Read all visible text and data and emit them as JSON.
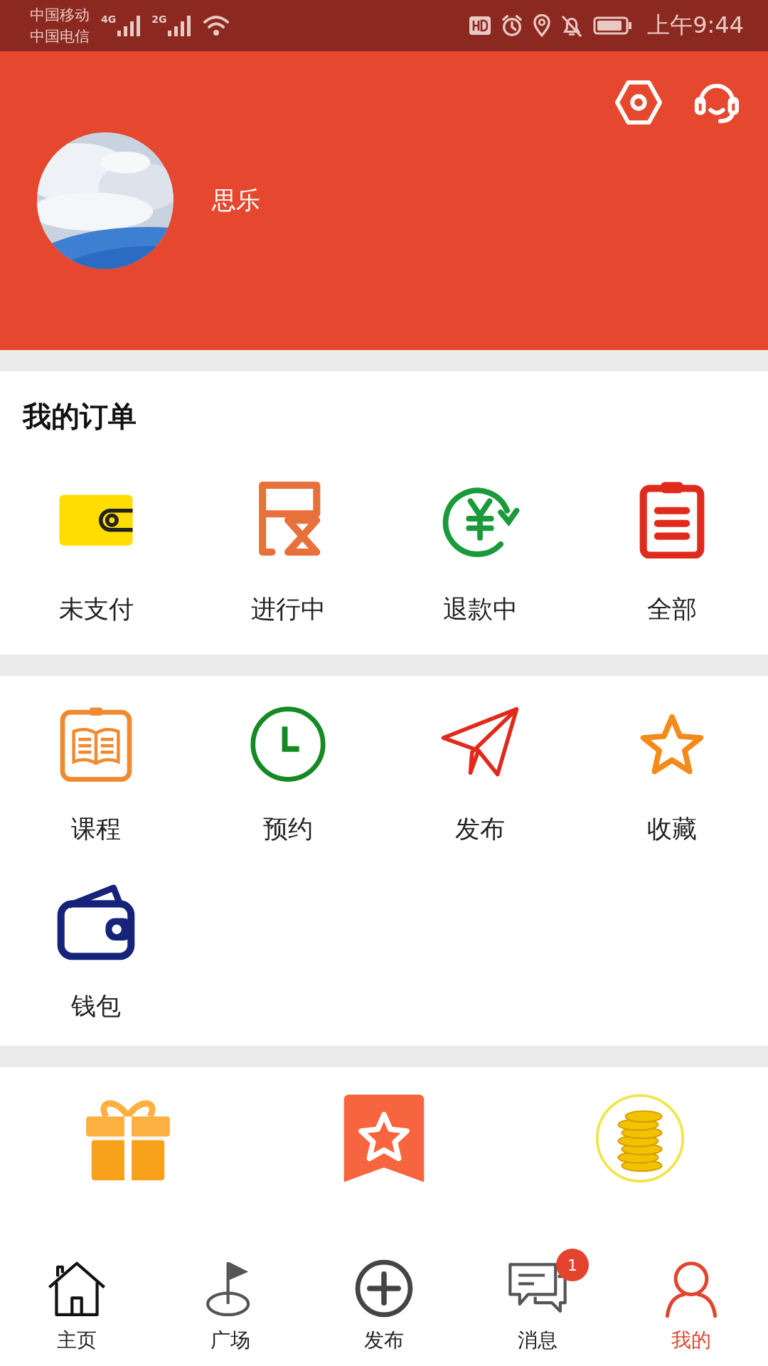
{
  "status_bar": {
    "carriers": [
      "中国移动",
      "中国电信"
    ],
    "network_1": "4G",
    "network_2": "2G",
    "time": "上午9:44"
  },
  "profile": {
    "name": "思乐"
  },
  "orders": {
    "title": "我的订单",
    "items": [
      {
        "label": "未支付"
      },
      {
        "label": "进行中"
      },
      {
        "label": "退款中"
      },
      {
        "label": "全部"
      }
    ]
  },
  "services": {
    "items": [
      {
        "label": "课程"
      },
      {
        "label": "预约"
      },
      {
        "label": "发布"
      },
      {
        "label": "收藏"
      },
      {
        "label": "钱包"
      }
    ]
  },
  "tab_bar": [
    {
      "label": "主页",
      "selected": false
    },
    {
      "label": "广场",
      "selected": false
    },
    {
      "label": "发布",
      "selected": false
    },
    {
      "label": "消息",
      "selected": false,
      "badge": "1"
    },
    {
      "label": "我的",
      "selected": true
    }
  ]
}
